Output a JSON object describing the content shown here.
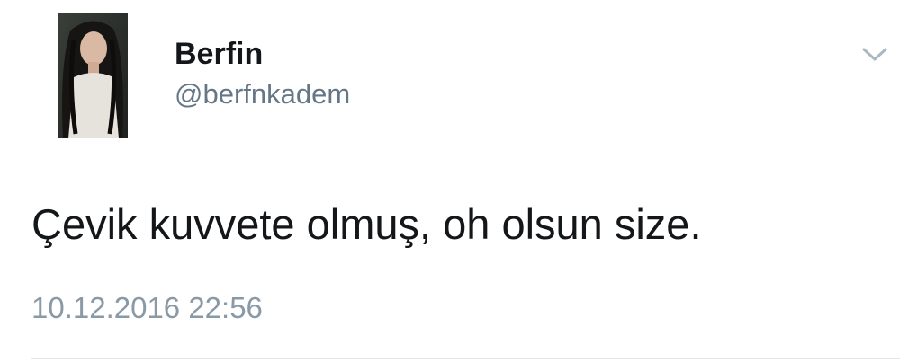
{
  "tweet": {
    "display_name": "Berfin",
    "handle": "@berfnkadem",
    "text": "Çevik kuvvete olmuş, oh olsun size.",
    "timestamp": "10.12.2016 22:56"
  },
  "icons": {
    "avatar": "avatar-photo",
    "menu": "chevron-down-icon"
  },
  "colors": {
    "name": "#14171a",
    "handle": "#657786",
    "timestamp": "#8a99a6",
    "divider": "#e1e8ed"
  }
}
